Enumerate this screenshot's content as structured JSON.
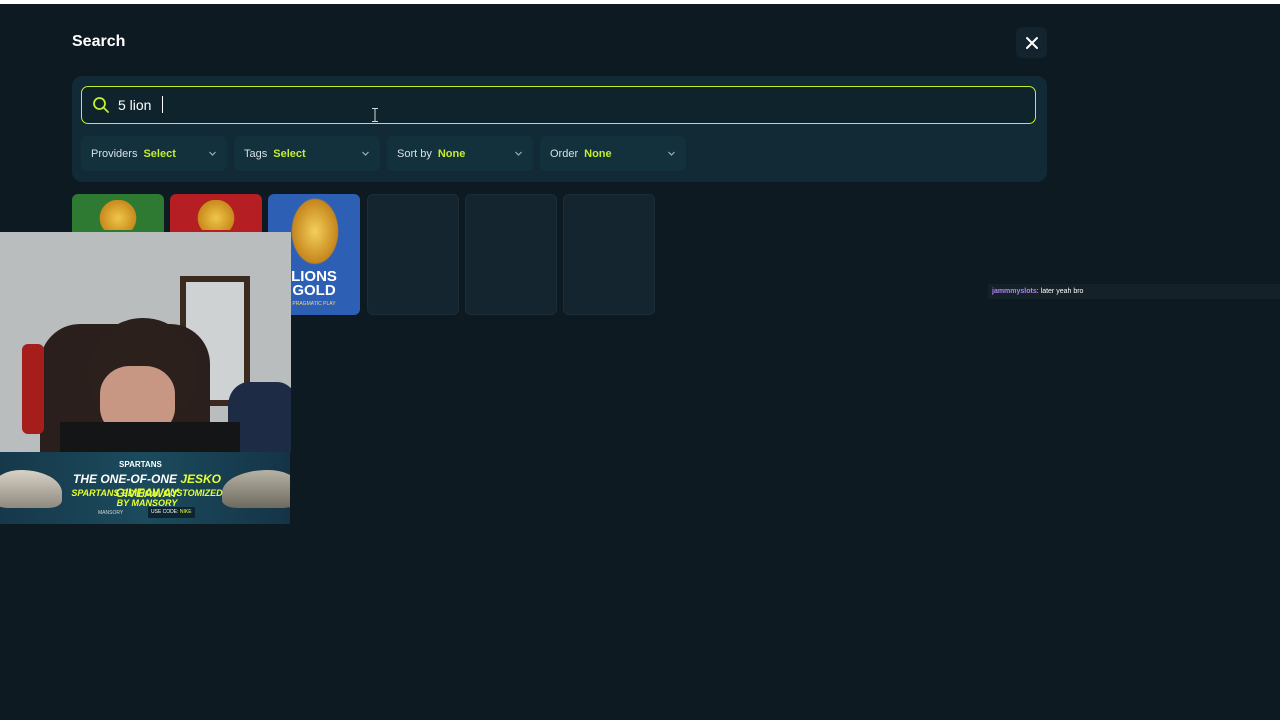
{
  "header": {
    "title": "Search"
  },
  "search": {
    "value": "5 lion"
  },
  "filters": [
    {
      "label": "Providers",
      "value": "Select"
    },
    {
      "label": "Tags",
      "value": "Select"
    },
    {
      "label": "Sort by",
      "value": "None"
    },
    {
      "label": "Order",
      "value": "None"
    }
  ],
  "results": {
    "tile3_title": "LIONS GOLD",
    "tile3_provider": "PRAGMATIC PLAY"
  },
  "overlay": {
    "banner_brand": "SPARTANS",
    "banner_line1_a": "THE ONE-OF-ONE ",
    "banner_line1_b": "JESKO GIVEAWAY",
    "banner_line2": "SPARTANS EDITION. CUSTOMIZED BY MANSORY",
    "banner_mansory": "MANSORY",
    "banner_code_a": "USE CODE: ",
    "banner_code_b": "NIKE",
    "chat_user": "jammmyslots",
    "chat_message": ": later yeah bro"
  },
  "colors": {
    "accent": "#c3ee2a",
    "background": "#0e1a22",
    "panel": "#122a36",
    "chat_user": "#b482ff"
  },
  "icons": {
    "close": "close-icon",
    "search": "search-icon",
    "chevron": "chevron-down-icon"
  }
}
